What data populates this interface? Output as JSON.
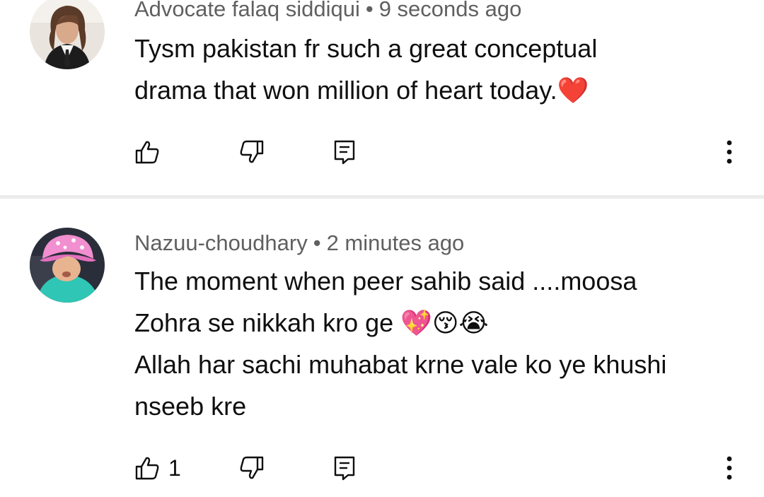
{
  "comments": [
    {
      "author": "Advocate falaq siddiqui",
      "separator": "•",
      "time": "9 seconds ago",
      "lines": [
        "Tysm pakistan fr such a great conceptual",
        "drama that won million of heart today.❤️"
      ],
      "like_count": ""
    },
    {
      "author": "Nazuu-choudhary",
      "separator": "•",
      "time": "2 minutes ago",
      "lines": [
        "The moment when peer sahib said ....moosa",
        "Zohra se nikkah kro ge 💖😚😭",
        "Allah har sachi muhabat krne vale ko ye khushi",
        "nseeb kre"
      ],
      "like_count": "1"
    }
  ],
  "icons": {
    "like": "thumbs-up-icon",
    "dislike": "thumbs-down-icon",
    "reply": "reply-icon",
    "more": "more-vertical-icon"
  },
  "colors": {
    "meta_text": "#606060",
    "body_text": "#0f0f0f",
    "divider": "#ececec"
  }
}
